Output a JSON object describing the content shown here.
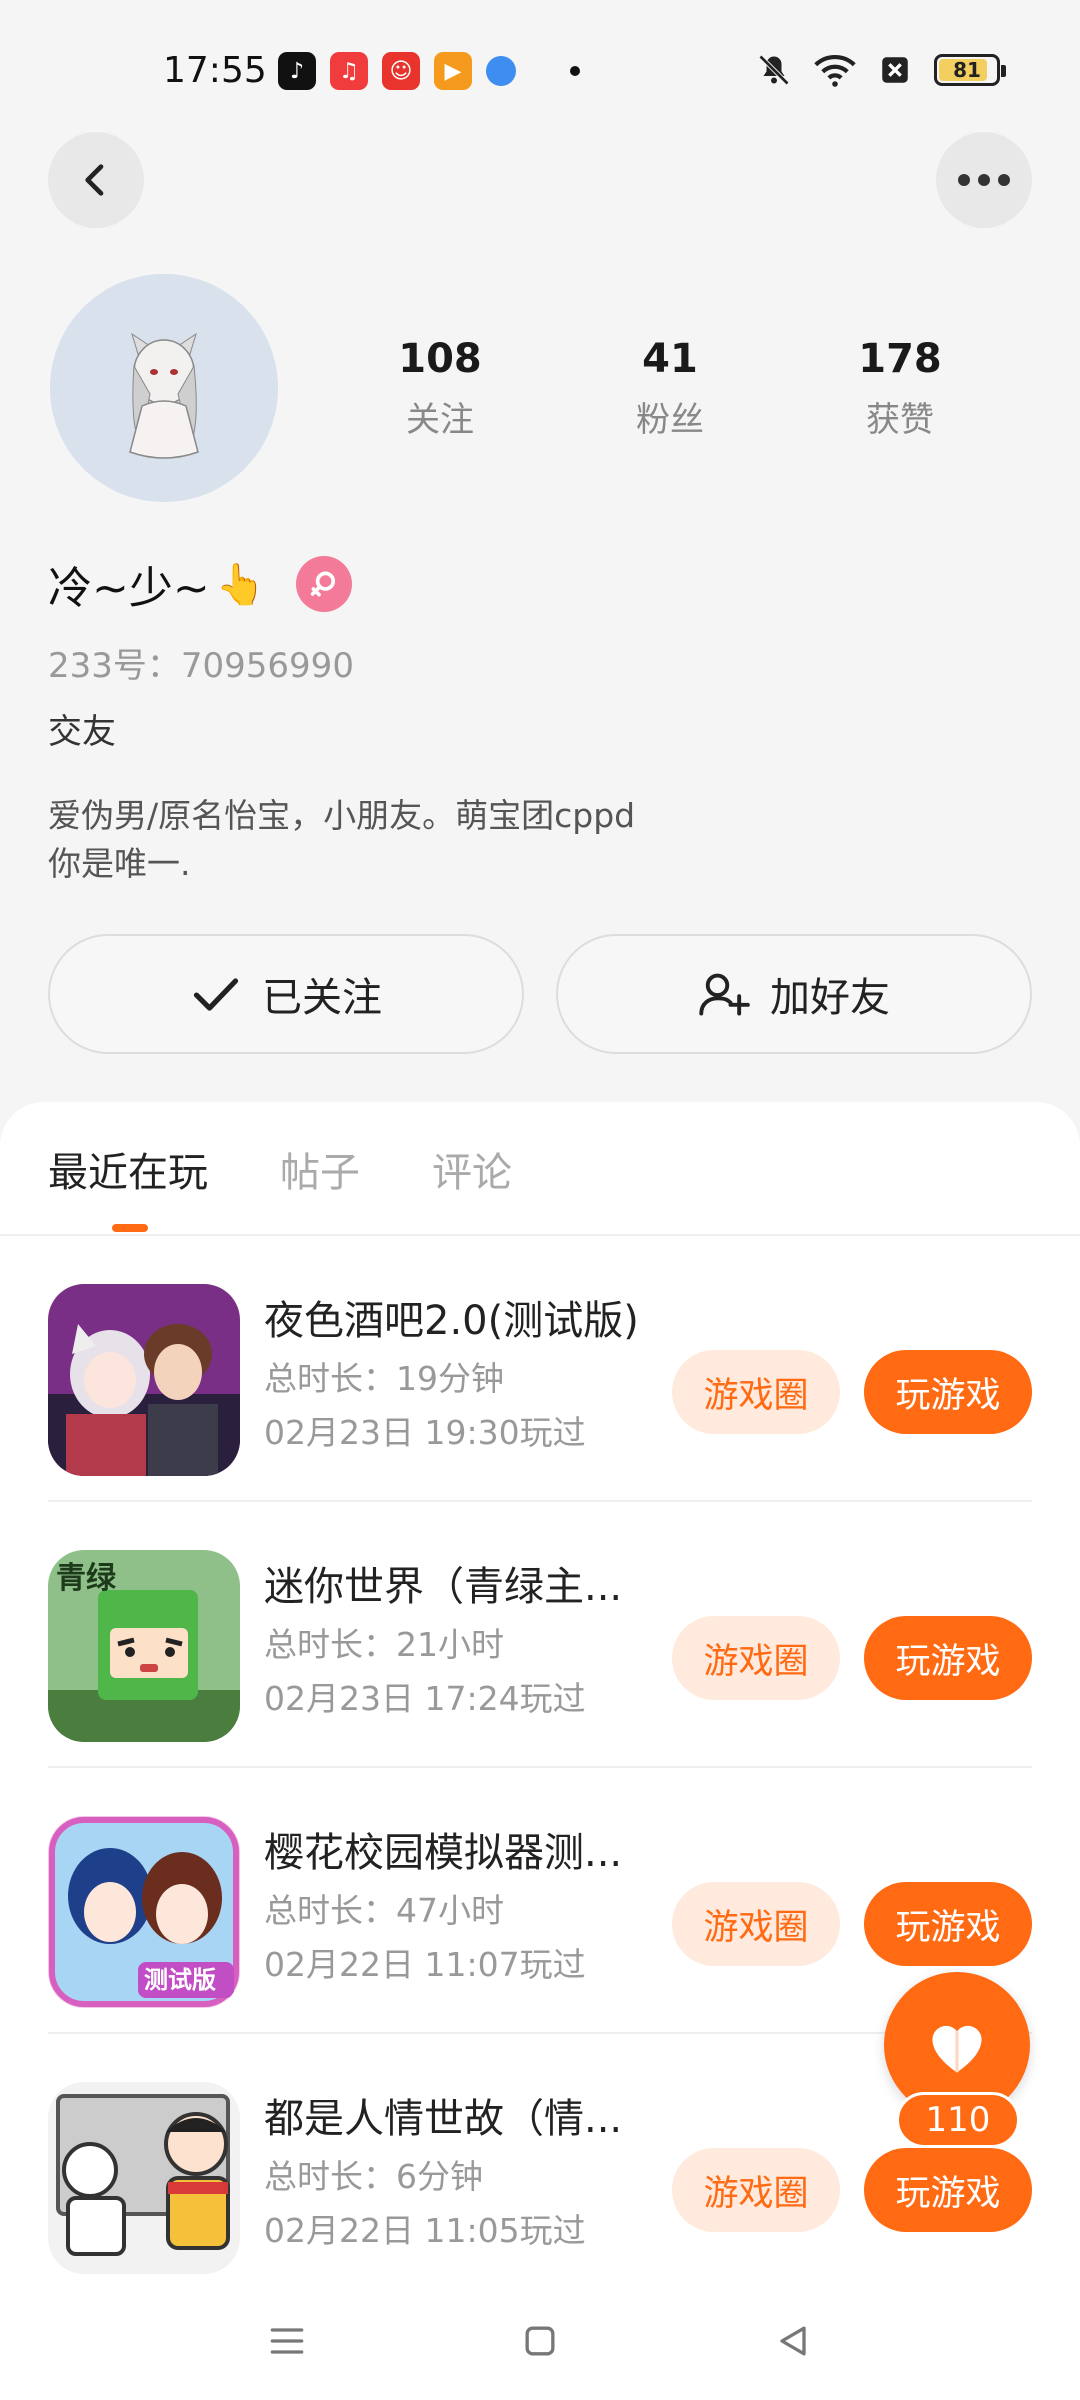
{
  "status_bar": {
    "time": "17:55",
    "battery": "81",
    "apps": [
      "tiktok-icon",
      "music-icon",
      "chat-icon",
      "video-icon",
      "browser-icon"
    ]
  },
  "profile": {
    "stats": [
      {
        "num": "108",
        "label": "关注"
      },
      {
        "num": "41",
        "label": "粉丝"
      },
      {
        "num": "178",
        "label": "获赞"
      }
    ],
    "name": "冷~少~",
    "hand_emoji": "👆",
    "uid": "233号：70956990",
    "tag": "交友",
    "bio": "爱伪男/原名怡宝，小朋友。萌宝团cppd你是唯一.",
    "followed_label": "已关注",
    "add_friend_label": "加好友"
  },
  "tabs": [
    {
      "label": "最近在玩",
      "active": true
    },
    {
      "label": "帖子",
      "active": false
    },
    {
      "label": "评论",
      "active": false
    }
  ],
  "games": [
    {
      "title": "夜色酒吧2.0(测试版)",
      "duration": "总时长：19分钟",
      "last_played": "02月23日 19:30玩过",
      "circle_label": "游戏圈",
      "play_label": "玩游戏"
    },
    {
      "title": "迷你世界（青绿主...",
      "duration": "总时长：21小时",
      "last_played": "02月23日 17:24玩过",
      "circle_label": "游戏圈",
      "play_label": "玩游戏"
    },
    {
      "title": "樱花校园模拟器测...",
      "duration": "总时长：47小时",
      "last_played": "02月22日 11:07玩过",
      "circle_label": "游戏圈",
      "play_label": "玩游戏"
    },
    {
      "title": "都是人情世故（情...",
      "duration": "总时长：6分钟",
      "last_played": "02月22日 11:05玩过",
      "circle_label": "游戏圈",
      "play_label": "玩游戏"
    }
  ],
  "like_count": "110",
  "colors": {
    "accent": "#ff6a13",
    "accent_light": "#ffeadd"
  }
}
